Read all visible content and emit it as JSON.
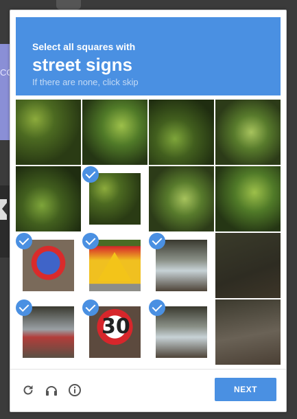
{
  "background": {
    "left_panel_fragment": "CO"
  },
  "header": {
    "instruction": "Select all squares with",
    "target": "street signs",
    "hint": "If there are none, click skip"
  },
  "footer": {
    "next_label": "NEXT",
    "icons": [
      "reload-icon",
      "audio-icon",
      "info-icon"
    ]
  },
  "grid": {
    "rows": 4,
    "cols": 4,
    "selected": [
      [
        1,
        1
      ],
      [
        2,
        0
      ],
      [
        2,
        1
      ],
      [
        2,
        2
      ],
      [
        3,
        0
      ],
      [
        3,
        1
      ],
      [
        3,
        2
      ]
    ]
  },
  "accent_color": "#4a90e2"
}
